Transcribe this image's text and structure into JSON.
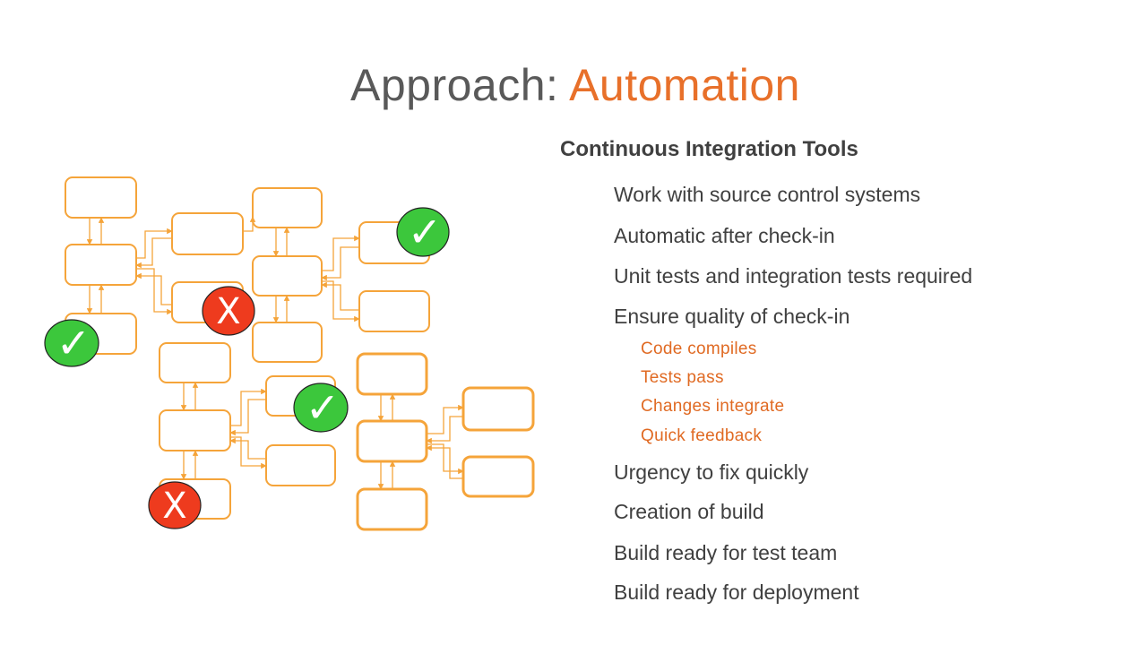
{
  "slide": {
    "title_prefix": "Approach: ",
    "title_accent": "Automation",
    "accent_color": "#E8702A"
  },
  "content": {
    "heading": "Continuous Integration Tools",
    "items": [
      "Work with source control systems",
      "Automatic after check-in",
      "Unit tests and integration tests required",
      "Ensure quality of check-in"
    ],
    "sub_items": [
      "Code compiles",
      "Tests pass",
      "Changes integrate",
      "Quick feedback"
    ],
    "items_after": [
      "Urgency to fix quickly",
      "Creation of build",
      "Build ready for test team",
      "Build ready for deployment"
    ]
  },
  "diagram": {
    "box_color": "#F5A43A",
    "pass_color": "#3CC73C",
    "fail_color": "#EE3B1E",
    "pass_symbol": "✓",
    "fail_symbol": "X",
    "badges": [
      {
        "type": "pass",
        "label": "build-pass-top-right"
      },
      {
        "type": "fail",
        "label": "build-fail-upper"
      },
      {
        "type": "pass",
        "label": "build-pass-left"
      },
      {
        "type": "pass",
        "label": "build-pass-middle"
      },
      {
        "type": "fail",
        "label": "build-fail-lower"
      }
    ]
  }
}
